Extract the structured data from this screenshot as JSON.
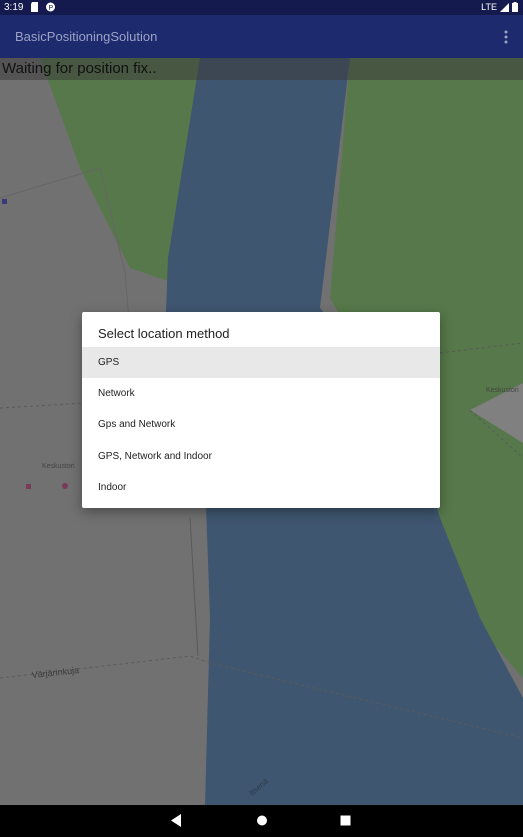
{
  "status": {
    "time": "3:19",
    "network": "LTE"
  },
  "app": {
    "title": "BasicPositioningSolution"
  },
  "banner": {
    "text": "Waiting for position fix.."
  },
  "map": {
    "labels": [
      "Keskustori",
      "Keskustori",
      "Värjärinkuja",
      "Itsenä"
    ],
    "colors": {
      "land": "#707070",
      "water": "#3f5670",
      "park": "#547748"
    }
  },
  "dialog": {
    "title": "Select location method",
    "options": [
      {
        "label": "GPS",
        "selected": true
      },
      {
        "label": "Network",
        "selected": false
      },
      {
        "label": "Gps and Network",
        "selected": false
      },
      {
        "label": "GPS, Network and Indoor",
        "selected": false
      },
      {
        "label": "Indoor",
        "selected": false
      }
    ]
  },
  "nav": {
    "back_icon": "triangle-back-icon",
    "home_icon": "circle-home-icon",
    "recents_icon": "square-recents-icon"
  }
}
